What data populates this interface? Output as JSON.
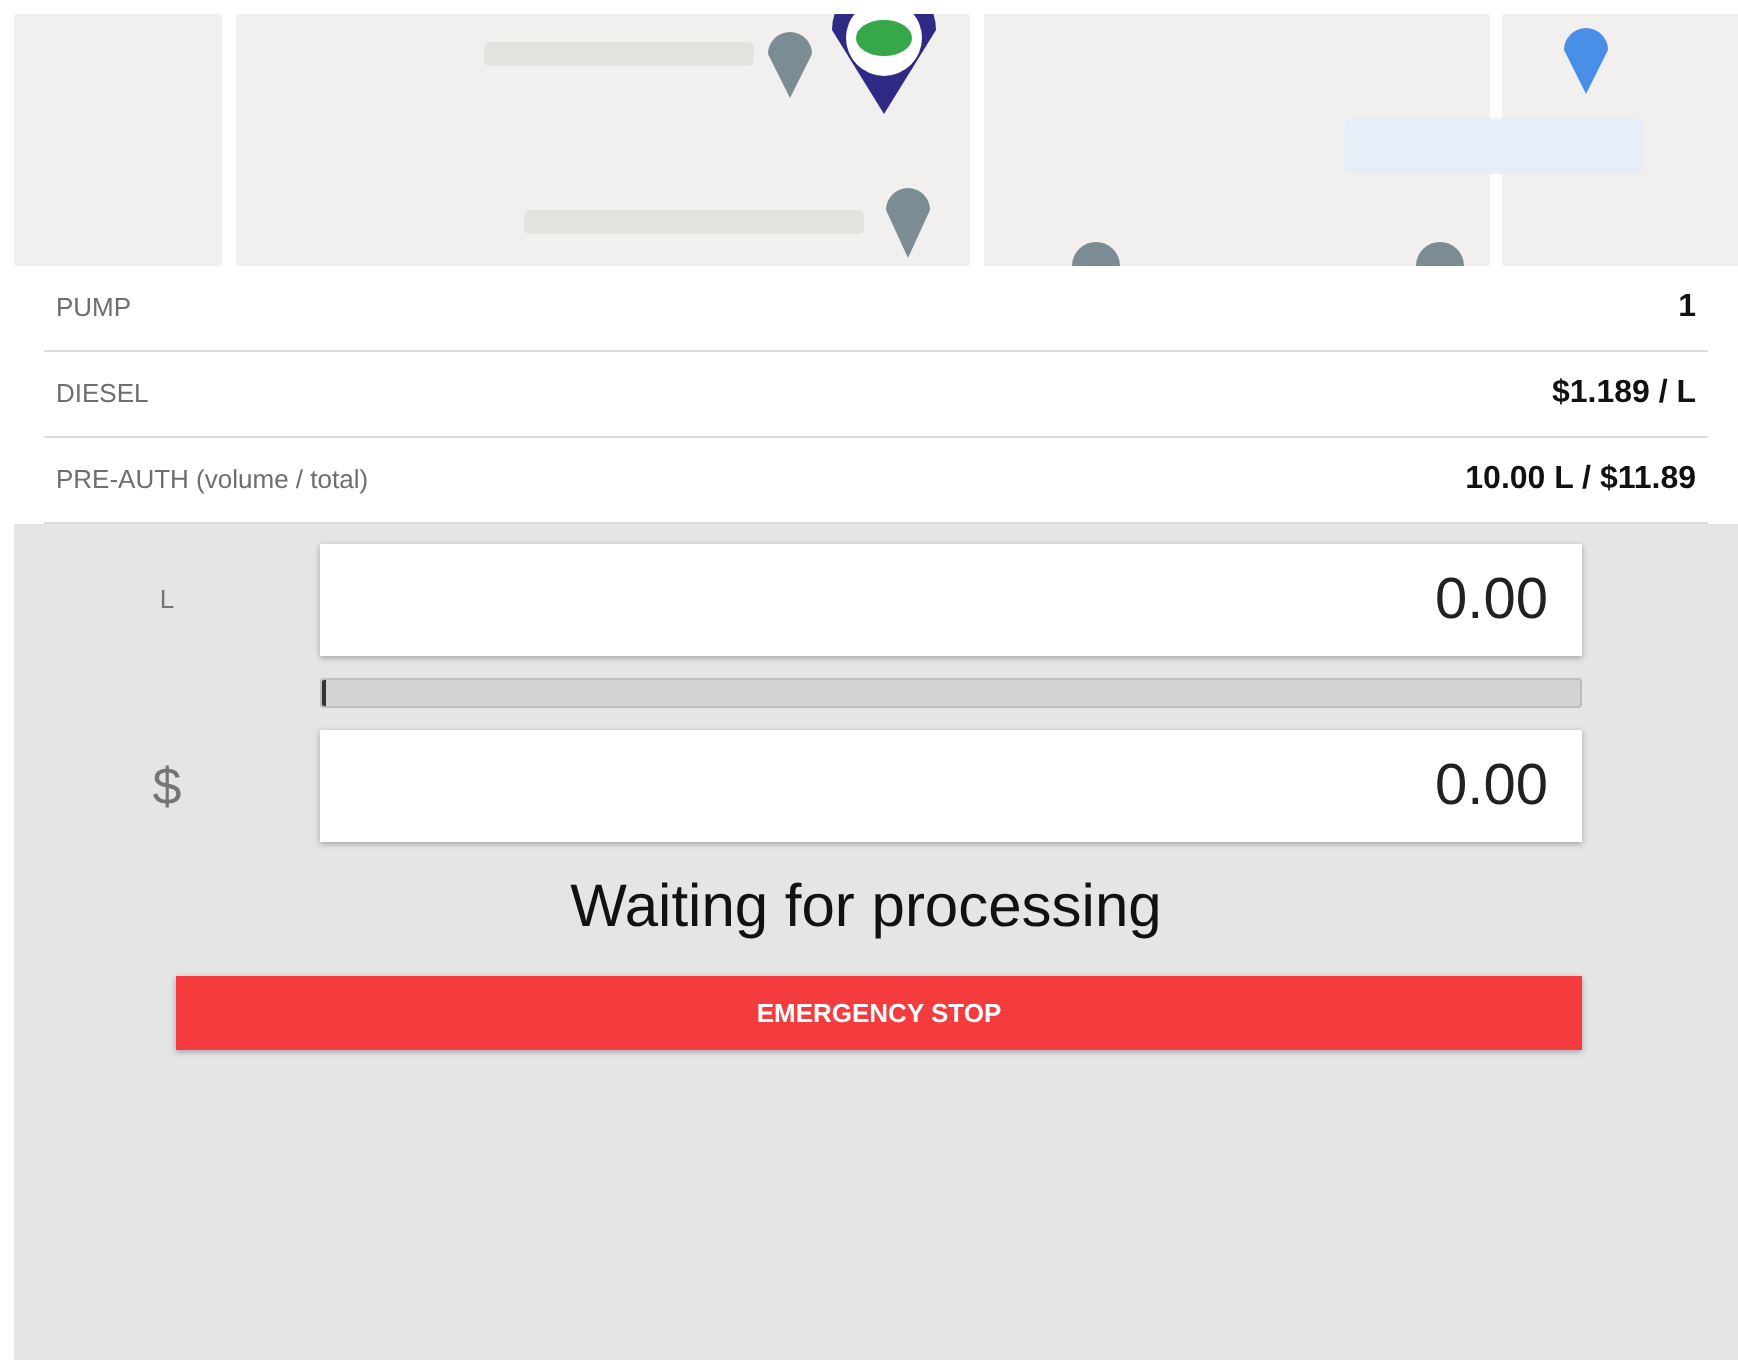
{
  "details": [
    {
      "label": "PUMP",
      "value": "1"
    },
    {
      "label": "DIESEL",
      "value": "$1.189 / L"
    },
    {
      "label": "PRE-AUTH (volume / total)",
      "value": "10.00 L / $11.89"
    }
  ],
  "volume": {
    "unit": "L",
    "value": "0.00"
  },
  "progress": {
    "level": 0.003
  },
  "amount": {
    "unit": "$",
    "value": "0.00"
  },
  "status": "Waiting for processing",
  "button": "EMERGENCY STOP"
}
